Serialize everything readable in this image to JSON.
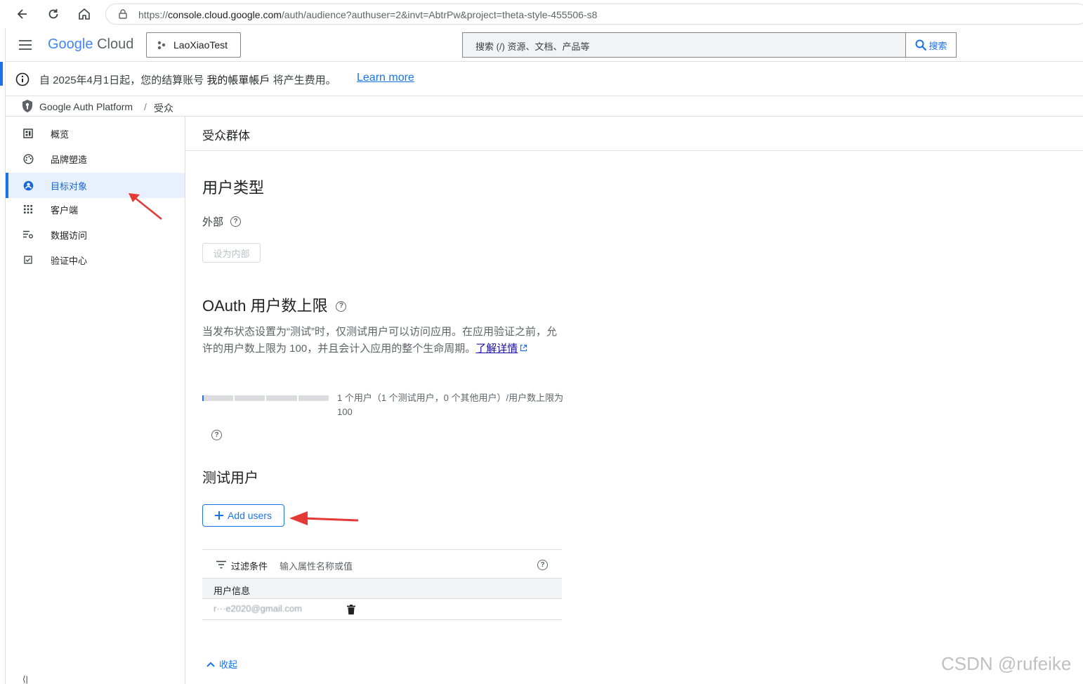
{
  "browser": {
    "url_prefix": "https://",
    "url_host": "console.cloud.google.com",
    "url_rest": "/auth/audience?authuser=2&invt=AbtrPw&project=theta-style-455506-s8"
  },
  "header": {
    "logo_google": "Google",
    "logo_cloud": "Cloud",
    "project_name": "LaoXiaoTest",
    "search_placeholder": "搜索 (/) 资源、文档、产品等",
    "search_button": "搜索"
  },
  "banner": {
    "text_before": "自 2025年4月1日起，您的结算账号",
    "account": "我的帳單帳戶",
    "text_after": "将产生费用。",
    "learn_more": "Learn more"
  },
  "breadcrumb": {
    "product": "Google Auth Platform",
    "separator": "/",
    "page": "受众"
  },
  "sidebar": {
    "items": [
      {
        "label": "概览",
        "icon": "dashboard-icon"
      },
      {
        "label": "品牌塑造",
        "icon": "palette-icon"
      },
      {
        "label": "目标对象",
        "icon": "account-circle-icon"
      },
      {
        "label": "客户端",
        "icon": "apps-grid-icon"
      },
      {
        "label": "数据访问",
        "icon": "settings-list-icon"
      },
      {
        "label": "验证中心",
        "icon": "check-box-icon"
      }
    ],
    "collapse_glyph": "⟨|"
  },
  "main": {
    "page_title": "受众群体",
    "user_type": {
      "heading": "用户类型",
      "value": "外部",
      "set_internal_button": "设为内部"
    },
    "oauth_limit": {
      "heading": "OAuth 用户数上限",
      "description": "当发布状态设置为“测试”时，仅测试用户可以访问应用。在应用验证之前，允许的用户数上限为 100，并且会计入应用的整个生命周期。",
      "learn_more": "了解详情",
      "progress_fraction": 0.01,
      "usage_text": "1 个用户（1 个测试用户，0 个其他用户）/用户数上限为 100"
    },
    "test_users": {
      "heading": "测试用户",
      "add_button": "Add users",
      "filter_label": "过滤条件",
      "filter_placeholder": "输入属性名称或值",
      "column_header": "用户信息",
      "rows": [
        {
          "email": "r···e2020@gmail.com"
        }
      ]
    },
    "collapse_link": "收起"
  },
  "watermark": "CSDN @rufeike",
  "colors": {
    "accent": "#1a73e8",
    "annotation_arrow": "#e53935"
  }
}
